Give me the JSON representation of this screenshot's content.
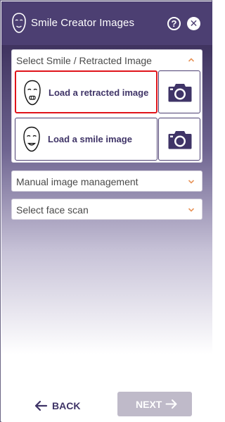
{
  "window": {
    "title": "Smile Creator Images",
    "help_label": "?",
    "close_label": "✕",
    "accent_color": "#4c3f72"
  },
  "sections": {
    "smile_retracted": {
      "label": "Select Smile / Retracted Image",
      "expanded": true,
      "retracted": {
        "label": "Load a retracted image",
        "icon": "face-retracted-icon",
        "selected": true
      },
      "smile": {
        "label": "Load a smile image",
        "icon": "face-smile-icon",
        "selected": false
      },
      "camera_icon": "camera-icon"
    },
    "manual": {
      "label": "Manual image management",
      "expanded": false
    },
    "face_scan": {
      "label": "Select face scan",
      "expanded": false
    }
  },
  "footer": {
    "back_label": "BACK",
    "next_label": "NEXT",
    "next_enabled": false
  },
  "colors": {
    "chevron": "#e8955a",
    "selection_outline": "#e0141b",
    "disabled_button": "#bfbac9"
  }
}
